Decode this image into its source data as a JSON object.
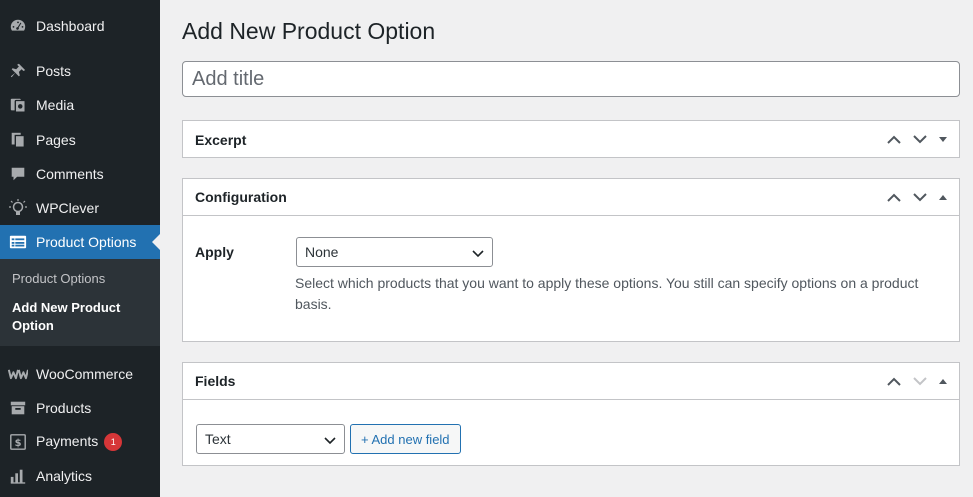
{
  "sidebar": {
    "items": [
      {
        "label": "Dashboard",
        "icon": "dashboard-icon"
      },
      {
        "label": "Posts",
        "icon": "pin-icon"
      },
      {
        "label": "Media",
        "icon": "media-icon"
      },
      {
        "label": "Pages",
        "icon": "pages-icon"
      },
      {
        "label": "Comments",
        "icon": "comment-icon"
      },
      {
        "label": "WPClever",
        "icon": "lightbulb-icon"
      },
      {
        "label": "Product Options",
        "icon": "list-view-icon"
      },
      {
        "label": "WooCommerce",
        "icon": "woo-icon"
      },
      {
        "label": "Products",
        "icon": "archive-icon"
      },
      {
        "label": "Payments",
        "icon": "payments-icon",
        "badge": "1"
      },
      {
        "label": "Analytics",
        "icon": "chart-bar-icon"
      }
    ],
    "submenu": [
      {
        "label": "Product Options"
      },
      {
        "label": "Add New Product Option"
      }
    ]
  },
  "main": {
    "title": "Add New Product Option",
    "title_placeholder": "Add title",
    "boxes": {
      "excerpt": {
        "title": "Excerpt"
      },
      "configuration": {
        "title": "Configuration",
        "apply_label": "Apply",
        "apply_value": "None",
        "description": "Select which products that you want to apply these options. You still can specify options on a product basis."
      },
      "fields": {
        "title": "Fields",
        "type_value": "Text",
        "add_button": "+ Add new field"
      }
    }
  },
  "colors": {
    "sidebar_bg": "#1d2327",
    "accent": "#2271b1",
    "badge": "#d63638"
  }
}
